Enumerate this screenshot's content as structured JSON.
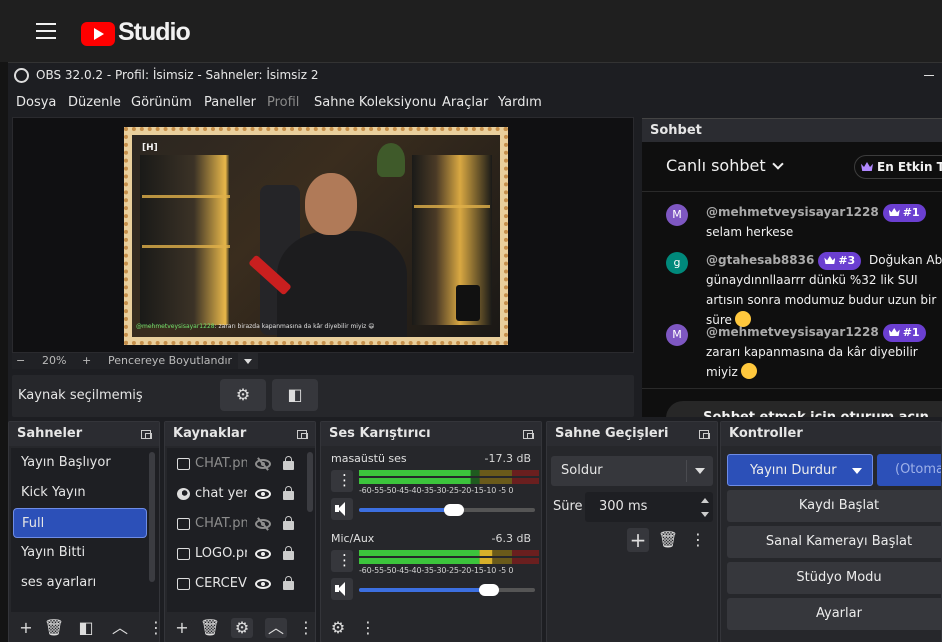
{
  "youtube": {
    "title": "Studio"
  },
  "window": {
    "title": "OBS 32.0.2 - Profil: İsimsiz - Sahneler: İsimsiz 2"
  },
  "menu": [
    "Dosya",
    "Düzenle",
    "Görünüm",
    "Paneller",
    "Profil",
    "Sahne Koleksiyonu",
    "Araçlar",
    "Yardım"
  ],
  "preview": {
    "overlay_user": "@mehmetveysisayar1228",
    "overlay_text": ": zararı birazda kapanmasına da kâr diyebilir miyiz 😄",
    "logo_text": "[H]"
  },
  "zoom": {
    "minus": "−",
    "value": "20%",
    "plus": "+",
    "fit_label": "Pencereye Boyutlandır"
  },
  "source_bar": {
    "label": "Kaynak seçilmemiş"
  },
  "chat": {
    "dock_title": "Sohbet",
    "title": "Canlı sohbet",
    "top_chip": "En Etkin Tak",
    "messages": [
      {
        "avatar": "M",
        "avatar_color": "#7e57c2",
        "author": "@mehmetveysisayar1228",
        "badge": "#1",
        "text": "selam herkese"
      },
      {
        "avatar": "g",
        "avatar_color": "#00897b",
        "author": "@gtahesab8836",
        "badge": "#3",
        "text": "Doğukan Abi günaydınnllaarrr dünkü %32 lik SUI artısın sonra modumuz budur uzun bir süre"
      },
      {
        "avatar": "M",
        "avatar_color": "#7e57c2",
        "author": "@mehmetveysisayar1228",
        "badge": "#1",
        "text": "zararı kapanmasına da kâr diyebilir miyiz"
      }
    ],
    "signin": "Sohbet etmek için oturum açın"
  },
  "scenes": {
    "title": "Sahneler",
    "items": [
      "Yayın Başlıyor",
      "Kick Yayın",
      "Full",
      "Yayın Bitti",
      "ses ayarları"
    ],
    "active_index": 2
  },
  "sources": {
    "title": "Kaynaklar",
    "items": [
      {
        "name": "CHAT.png",
        "icon": "image-icon",
        "visible": false
      },
      {
        "name": "chat yeni",
        "icon": "globe-icon",
        "visible": true
      },
      {
        "name": "CHAT.png",
        "icon": "image-icon",
        "visible": false
      },
      {
        "name": "LOGO.png",
        "icon": "image-icon",
        "visible": true
      },
      {
        "name": "CERCEVE",
        "icon": "image-icon",
        "visible": true
      }
    ]
  },
  "mixer": {
    "title": "Ses Karıştırıcı",
    "ticks": "-60-55-50-45-40-35-30-25-20-15-10 -5  0",
    "channels": [
      {
        "name": "masaüstü ses",
        "db": "-17.3 dB",
        "level": 0.62,
        "volume": 0.54
      },
      {
        "name": "Mic/Aux",
        "db": "-6.3 dB",
        "level": 0.74,
        "volume": 0.74
      }
    ]
  },
  "transitions": {
    "title": "Sahne Geçişleri",
    "selected": "Soldur",
    "duration_label": "Süre",
    "duration": "300 ms"
  },
  "controls": {
    "title": "Kontroller",
    "stream": "Yayını Durdur",
    "auto": "(Otoma",
    "record": "Kaydı Başlat",
    "vcam": "Sanal Kamerayı Başlat",
    "studio": "Stüdyo Modu",
    "settings": "Ayarlar"
  },
  "colors": {
    "accent": "#2c50b8",
    "meter_green": "#3cc43c",
    "meter_yellow": "#d8b02a",
    "meter_red": "#c83232",
    "youtube_red": "#ff0000"
  }
}
